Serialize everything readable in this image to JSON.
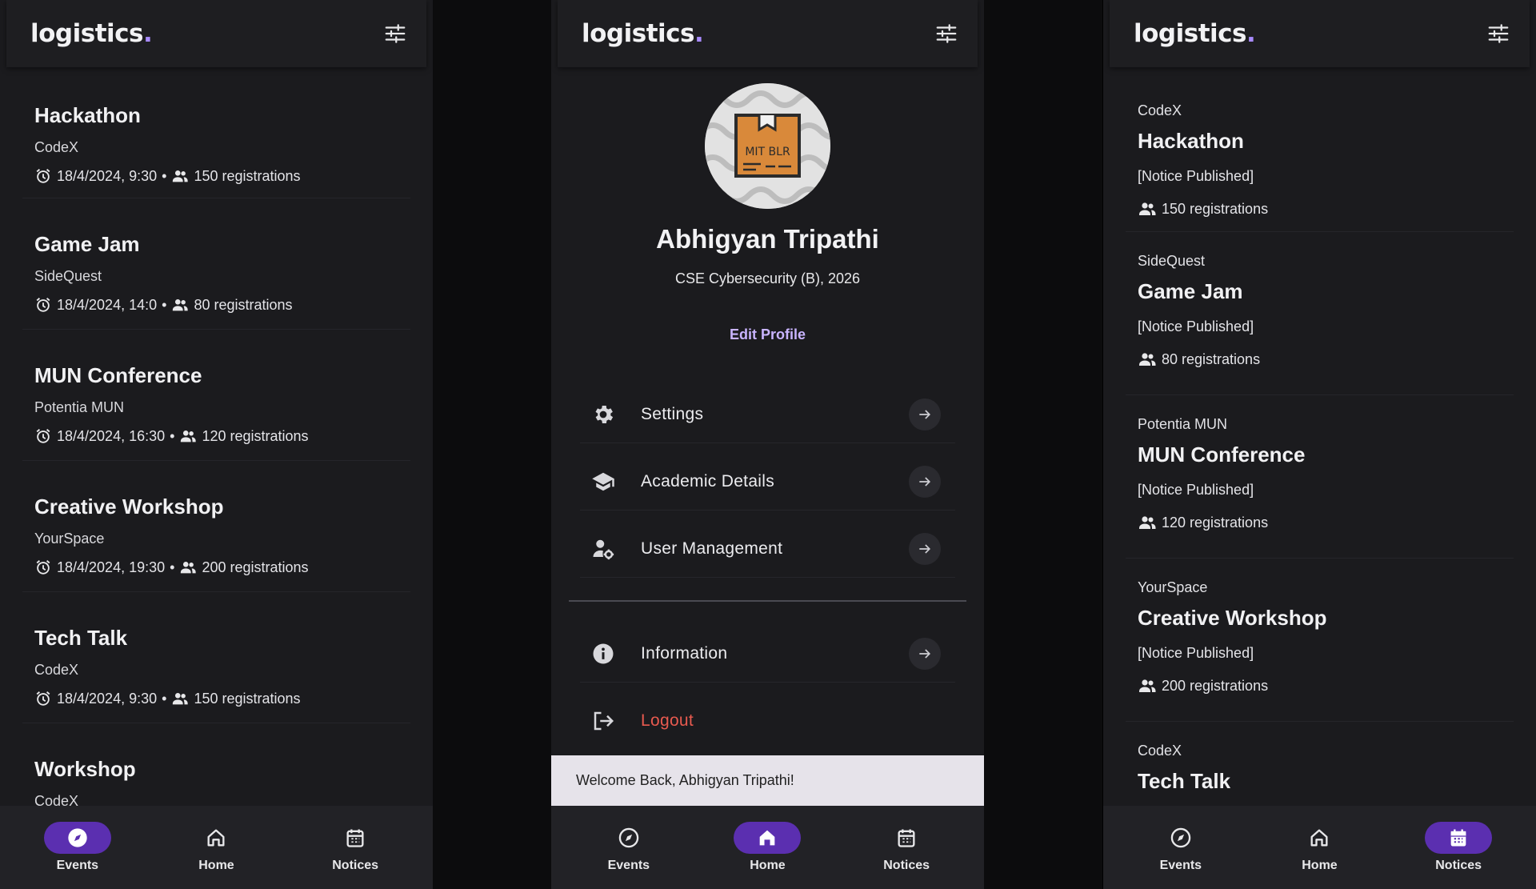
{
  "brand": {
    "name": "logistics",
    "dot": ".",
    "accent": "#a98bff"
  },
  "events_screen": {
    "events": [
      {
        "title": "Hackathon",
        "club": "CodeX",
        "datetime": "18/4/2024, 9:30",
        "sep": "•",
        "registrations": "150 registrations"
      },
      {
        "title": "Game Jam",
        "club": "SideQuest",
        "datetime": "18/4/2024, 14:0",
        "sep": "•",
        "registrations": "80 registrations"
      },
      {
        "title": "MUN Conference",
        "club": "Potentia MUN",
        "datetime": "18/4/2024, 16:30",
        "sep": "•",
        "registrations": "120 registrations"
      },
      {
        "title": "Creative Workshop",
        "club": "YourSpace",
        "datetime": "18/4/2024, 19:30",
        "sep": "•",
        "registrations": "200 registrations"
      },
      {
        "title": "Tech Talk",
        "club": "CodeX",
        "datetime": "18/4/2024, 9:30",
        "sep": "•",
        "registrations": "150 registrations"
      },
      {
        "title": "Workshop",
        "club": "CodeX",
        "datetime": "",
        "sep": "",
        "registrations": ""
      }
    ]
  },
  "profile_screen": {
    "avatar_text": "MIT BLR",
    "name": "Abhigyan Tripathi",
    "subtitle": "CSE Cybersecurity (B), 2026",
    "edit_label": "Edit Profile",
    "menu": [
      {
        "label": "Settings",
        "icon": "gear-icon"
      },
      {
        "label": "Academic Details",
        "icon": "graduation-cap-icon"
      },
      {
        "label": "User Management",
        "icon": "user-settings-icon"
      },
      {
        "label": "Information",
        "icon": "info-icon"
      },
      {
        "label": "Logout",
        "icon": "logout-icon"
      }
    ],
    "snackbar": "Welcome Back, Abhigyan Tripathi!",
    "logout_color": "#e85a4f"
  },
  "notices_screen": {
    "notices": [
      {
        "club": "CodeX",
        "title": "Hackathon",
        "status": "[Notice Published]",
        "registrations": "150 registrations"
      },
      {
        "club": "SideQuest",
        "title": "Game Jam",
        "status": "[Notice Published]",
        "registrations": "80 registrations"
      },
      {
        "club": "Potentia MUN",
        "title": "MUN Conference",
        "status": "[Notice Published]",
        "registrations": "120 registrations"
      },
      {
        "club": "YourSpace",
        "title": "Creative Workshop",
        "status": "[Notice Published]",
        "registrations": "200 registrations"
      },
      {
        "club": "CodeX",
        "title": "Tech Talk",
        "status": "",
        "registrations": ""
      }
    ]
  },
  "nav": {
    "events": "Events",
    "home": "Home",
    "notices": "Notices",
    "active_color": "#5b2fb0"
  }
}
